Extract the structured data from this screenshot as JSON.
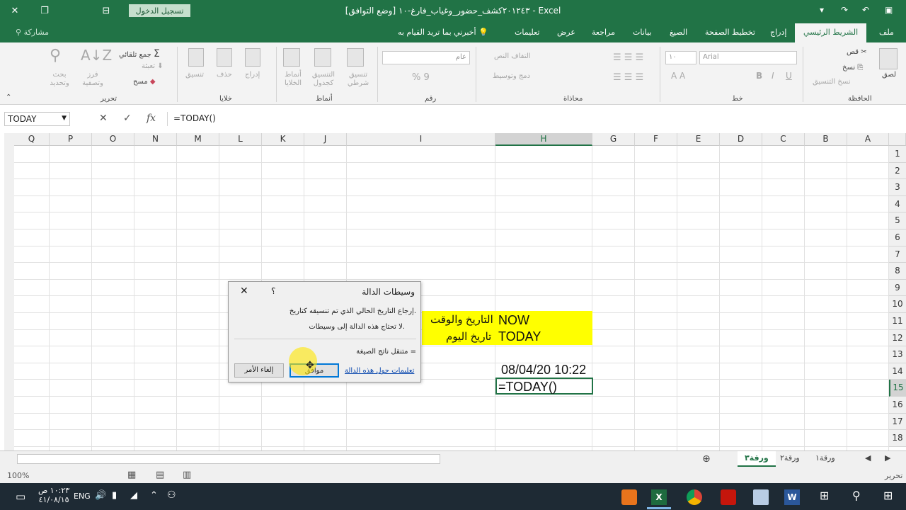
{
  "window": {
    "title": "٢٠١٢٤٣كشف_حضور_وغياب_فارغ-١٠  [وضع التوافق]  -  Excel",
    "sign_in": "تسجيل الدخول",
    "controls": {
      "close": "✕",
      "restore": "❐",
      "layout": "⊟",
      "minimize": "—"
    }
  },
  "ribbon_tabs": {
    "items": [
      "ملف",
      "الشريط الرئيسي",
      "إدراج",
      "تخطيط الصفحة",
      "الصيغ",
      "بيانات",
      "مراجعة",
      "عرض",
      "تعليمات"
    ],
    "tell_me": "أخبرني بما تريد القيام به",
    "share": "مشاركة"
  },
  "ribbon": {
    "clipboard": {
      "group": "الحافظة",
      "paste": "لصق",
      "cut": "قص",
      "copy": "نسخ",
      "format_painter": "نسخ التنسيق"
    },
    "font": {
      "group": "خط",
      "font_name": "Arial",
      "font_size": "١٠"
    },
    "alignment": {
      "group": "محاذاة",
      "wrap": "التفاف النص",
      "merge": "دمج وتوسيط"
    },
    "number": {
      "group": "رقم",
      "format": "عام"
    },
    "styles": {
      "group": "أنماط",
      "conditional": "تنسيق شرطي",
      "table": "التنسيق كجدول",
      "cell": "أنماط الخلايا"
    },
    "cells": {
      "group": "خلايا",
      "insert": "إدراج",
      "delete": "حذف",
      "format": "تنسيق"
    },
    "editing": {
      "group": "تحرير",
      "autosum": "جمع تلقائي",
      "fill": "تعبئة",
      "clear": "مسح",
      "sort": "فرز وتصفية",
      "find": "بحث وتحديد"
    }
  },
  "formula_bar": {
    "name_box": "TODAY",
    "cancel": "✕",
    "enter": "✓",
    "fx": "fx",
    "formula": "=TODAY()"
  },
  "grid": {
    "columns": [
      "Q",
      "P",
      "O",
      "N",
      "M",
      "L",
      "K",
      "J",
      "I",
      "H",
      "G",
      "F",
      "E",
      "D",
      "C",
      "B",
      "A"
    ],
    "rows": [
      "1",
      "2",
      "3",
      "4",
      "5",
      "6",
      "7",
      "8",
      "9",
      "10",
      "11",
      "12",
      "13",
      "14",
      "15",
      "16",
      "17",
      "18"
    ],
    "selected_column": "H",
    "selected_row": "15",
    "cells": {
      "now_label": "NOW",
      "now_desc": "التاريخ والوقت",
      "today_label": "TODAY",
      "today_desc": "تاريخ اليوم",
      "now_value": "08/04/20 10:22",
      "today_formula": "=TODAY()"
    },
    "highlight_color": "#ffff00"
  },
  "dialog": {
    "title": "وسيطات الدالة",
    "help": "؟",
    "close": "✕",
    "description": "إرجاع التاريخ الحالي الذي تم تنسيقه كتاريخ.",
    "no_args": "لا تحتاج هذه الدالة إلى وسيطات.",
    "result_label": "ناتج الصيغة =",
    "result_value": "متنقل",
    "help_link": "تعليمات حول هذه الدالة",
    "ok": "موافق",
    "cancel": "إلغاء الأمر"
  },
  "sheet_tabs": {
    "items": [
      "ورقة٣",
      "ورقة٢",
      "ورقة١"
    ],
    "active": "ورقة٣",
    "add": "⊕"
  },
  "status_bar": {
    "mode": "تحرير",
    "zoom": "100%"
  },
  "taskbar": {
    "time": "١٠:٢٣ ص",
    "date": "٤١/٠٨/١٥",
    "lang": "ENG",
    "apps": [
      "file-explorer",
      "search",
      "word",
      "word-doc",
      "acrobat",
      "chrome",
      "excel",
      "media"
    ]
  },
  "colors": {
    "excel_green": "#217346",
    "taskbar": "#1e2a34"
  }
}
